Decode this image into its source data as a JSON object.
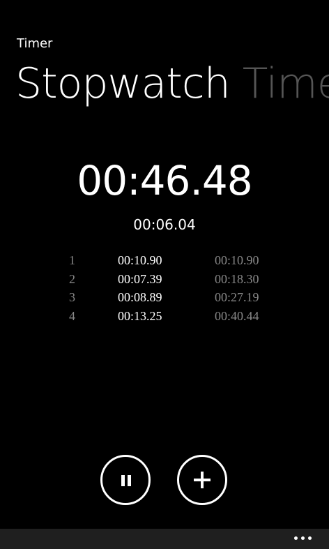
{
  "app": {
    "title": "Timer"
  },
  "pivot": {
    "items": [
      {
        "label": "Stopwatch",
        "active": true
      },
      {
        "label": "Timer",
        "active": false
      }
    ]
  },
  "stopwatch": {
    "elapsed": "00:46.48",
    "current_lap": "00:06.04",
    "laps": [
      {
        "number": "1",
        "split": "00:10.90",
        "total": "00:10.90"
      },
      {
        "number": "2",
        "split": "00:07.39",
        "total": "00:18.30"
      },
      {
        "number": "3",
        "split": "00:08.89",
        "total": "00:27.19"
      },
      {
        "number": "4",
        "split": "00:13.25",
        "total": "00:40.44"
      }
    ]
  },
  "controls": {
    "pause_icon": "pause-icon",
    "lap_icon": "plus-icon"
  },
  "app_bar": {
    "more_icon": "ellipsis-icon"
  },
  "colors": {
    "background": "#000000",
    "foreground": "#ffffff",
    "muted": "#888888",
    "inactive_header": "#555555",
    "app_bar": "#1f1f1f"
  }
}
